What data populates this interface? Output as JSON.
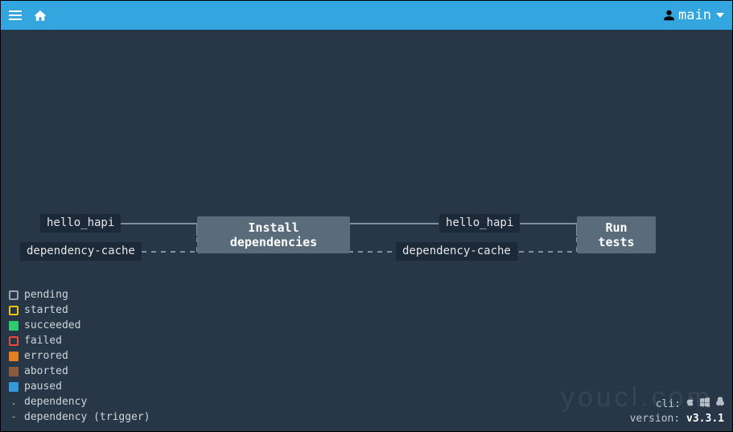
{
  "topbar": {
    "team_label": "main"
  },
  "pipeline": {
    "resources_in": [
      {
        "name": "hello_hapi"
      },
      {
        "name": "dependency-cache"
      }
    ],
    "jobs": [
      {
        "name": "Install dependencies"
      },
      {
        "name": "Run tests"
      }
    ],
    "resources_mid": [
      {
        "name": "hello_hapi"
      },
      {
        "name": "dependency-cache"
      }
    ]
  },
  "legend": {
    "items": [
      {
        "kind": "box",
        "color": "#9aa7b2",
        "label": "pending"
      },
      {
        "kind": "box",
        "color": "#f1c40f",
        "label": "started"
      },
      {
        "kind": "fill",
        "color": "#2ecc71",
        "label": "succeeded"
      },
      {
        "kind": "box",
        "color": "#e74c3c",
        "label": "failed"
      },
      {
        "kind": "fill",
        "color": "#e67e22",
        "label": "errored"
      },
      {
        "kind": "fill",
        "color": "#8b5a3c",
        "label": "aborted"
      },
      {
        "kind": "fill",
        "color": "#3498db",
        "label": "paused"
      },
      {
        "kind": "dot",
        "glyph": ".",
        "label": "dependency"
      },
      {
        "kind": "dot",
        "glyph": "-",
        "label": "dependency (trigger)"
      }
    ]
  },
  "footer": {
    "cli_label": "cli:",
    "version_label": "version:",
    "version_value": "v3.3.1"
  },
  "watermark": "youcl.com"
}
